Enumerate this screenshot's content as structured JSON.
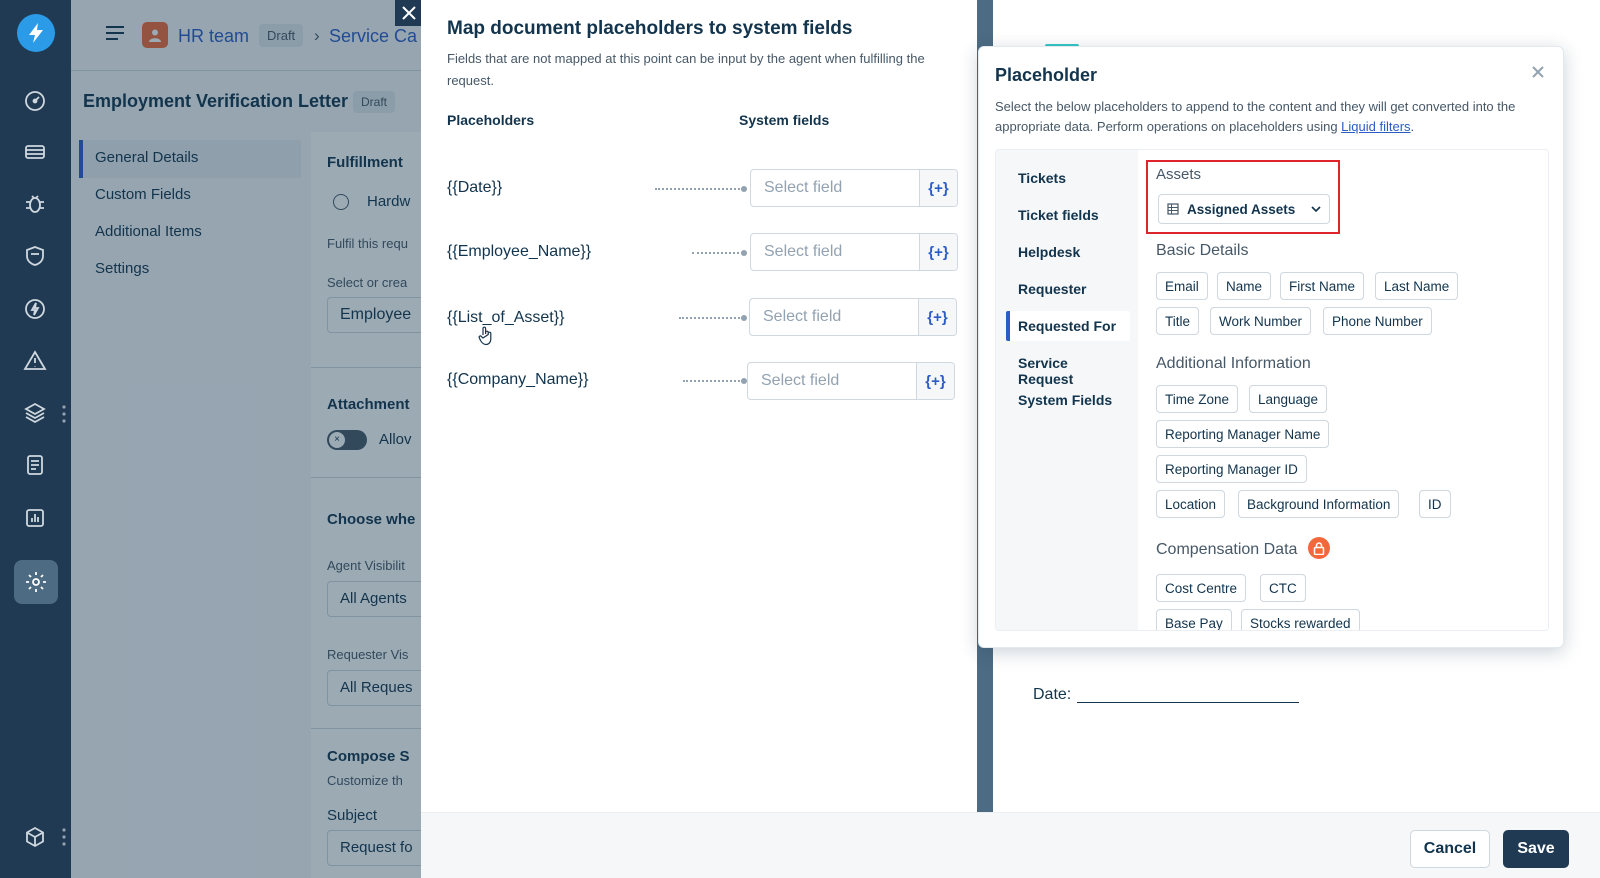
{
  "header": {
    "team_name": "HR team",
    "draft_badge": "Draft",
    "breadcrumb_next": "Service Ca",
    "page_title": "Employment Verification Letter",
    "title_badge": "Draft"
  },
  "sidebar": {
    "items": [
      {
        "label": "General Details"
      },
      {
        "label": "Custom Fields"
      },
      {
        "label": "Additional Items"
      },
      {
        "label": "Settings"
      }
    ]
  },
  "bg_form": {
    "fulfillment_heading": "Fulfillment",
    "radio_label": "Hardw",
    "fulfil_text": "Fulfil this requ",
    "select_label": "Select or crea",
    "select_value": "Employee",
    "attachment_heading": "Attachment",
    "allow_label": "Allov",
    "choose_heading": "Choose whe",
    "agent_vis_label": "Agent Visibilit",
    "agent_vis_value": "All Agents",
    "requester_vis_label": "Requester Vis",
    "requester_vis_value": "All Reques",
    "compose_heading": "Compose S",
    "customize_text": "Customize th",
    "subject_label": "Subject",
    "subject_value": "Request fo"
  },
  "drawer": {
    "title": "Map document placeholders to system fields",
    "description": "Fields that are not mapped at this point can be input by the agent when fulfilling the request.",
    "col_placeholders": "Placeholders",
    "col_system_fields": "System fields",
    "rows": [
      {
        "placeholder": "{{Date}}",
        "select_placeholder": "Select field",
        "insert_label": "{+}"
      },
      {
        "placeholder": "{{Employee_Name}}",
        "select_placeholder": "Select field",
        "insert_label": "{+}"
      },
      {
        "placeholder": "{{List_of_Asset}}",
        "select_placeholder": "Select field",
        "insert_label": "{+}"
      },
      {
        "placeholder": "{{Company_Name}}",
        "select_placeholder": "Select field",
        "insert_label": "{+}"
      }
    ]
  },
  "document": {
    "date_label": "Date:"
  },
  "popover": {
    "title": "Placeholder",
    "description": "Select the below placeholders to append to the content and they will get converted into the appropriate data. Perform operations on placeholders using",
    "link_text": "Liquid filters",
    "tabs": [
      {
        "label": "Tickets"
      },
      {
        "label": "Ticket fields"
      },
      {
        "label": "Helpdesk"
      },
      {
        "label": "Requester"
      },
      {
        "label": "Requested For"
      },
      {
        "label": "Service Request"
      },
      {
        "label": "System Fields"
      }
    ],
    "assets_heading": "Assets",
    "assets_dropdown": "Assigned Assets",
    "basic_heading": "Basic Details",
    "basic_chips": [
      "Email",
      "Name",
      "First Name",
      "Last Name",
      "Title",
      "Work Number",
      "Phone Number"
    ],
    "additional_heading": "Additional Information",
    "additional_chips": [
      "Time Zone",
      "Language",
      "Reporting Manager Name",
      "Reporting Manager ID",
      "Location",
      "Background Information",
      "ID"
    ],
    "compensation_heading": "Compensation Data",
    "compensation_chips": [
      "Cost Centre",
      "CTC",
      "Base Pay",
      "Stocks rewarded"
    ]
  },
  "footer": {
    "cancel_label": "Cancel",
    "save_label": "Save"
  },
  "colors": {
    "nav_bg": "#1f3a52",
    "accent": "#2c5cc5",
    "highlight_border": "#e0242b",
    "lock_orange": "#f2683a"
  }
}
